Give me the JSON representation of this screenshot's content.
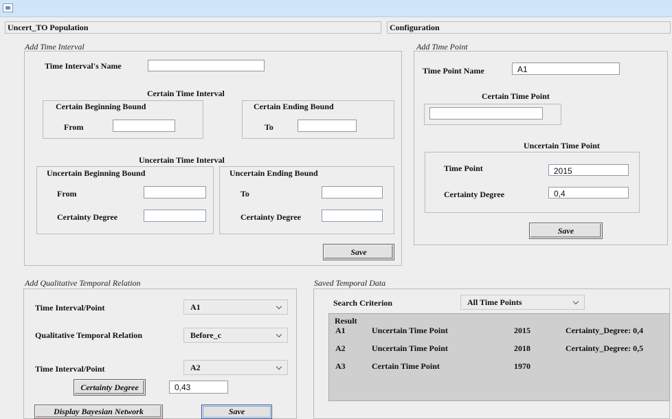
{
  "window": {
    "icon": "java-app-icon"
  },
  "tabs": {
    "population": "Uncert_TO Population",
    "configuration": "Configuration"
  },
  "time_interval": {
    "title": "Add Time Interval",
    "name_label": "Time Interval's Name",
    "name_value": "",
    "certain_title": "Certain Time Interval",
    "certain_begin_title": "Certain Beginning Bound",
    "certain_end_title": "Certain Ending Bound",
    "from_label": "From",
    "to_label": "To",
    "certain_from_value": "",
    "certain_to_value": "",
    "uncertain_title": "Uncertain Time Interval",
    "uncertain_begin_title": "Uncertain Beginning Bound",
    "uncertain_end_title": "Uncertain Ending Bound",
    "uncertain_from_value": "",
    "uncertain_to_value": "",
    "certainty_label": "Certainty Degree",
    "begin_certainty_value": "",
    "end_certainty_value": "",
    "save_label": "Save"
  },
  "time_point": {
    "title": "Add Time Point",
    "name_label": "Time Point Name",
    "name_value": "A1",
    "certain_title": "Certain Time Point",
    "certain_value": "",
    "uncertain_title": "Uncertain Time Point",
    "point_label": "Time Point",
    "point_value": "2015",
    "certainty_label": "Certainty Degree",
    "certainty_value": "0,4",
    "save_label": "Save"
  },
  "relation": {
    "title": "Add Qualitative Temporal Relation",
    "first_label": "Time Interval/Point",
    "first_value": "A1",
    "relation_label": "Qualitative Temporal Relation",
    "relation_value": "Before_c",
    "second_label": "Time Interval/Point",
    "second_value": "A2",
    "certainty_button": "Certainty Degree",
    "certainty_value": "0,43",
    "display_button": "Display Bayesian Network",
    "save_label": "Save"
  },
  "saved": {
    "title": "Saved Temporal Data",
    "search_label": "Search Criterion",
    "search_value": "All Time Points",
    "result_label": "Result",
    "rows": [
      {
        "id": "A1",
        "type": "Uncertain Time Point",
        "year": "2015",
        "degree": "Certainty_Degree: 0,4"
      },
      {
        "id": "A2",
        "type": "Uncertain Time Point",
        "year": "2018",
        "degree": "Certainty_Degree: 0,5"
      },
      {
        "id": "A3",
        "type": "Certain Time Point",
        "year": "1970",
        "degree": ""
      }
    ]
  }
}
